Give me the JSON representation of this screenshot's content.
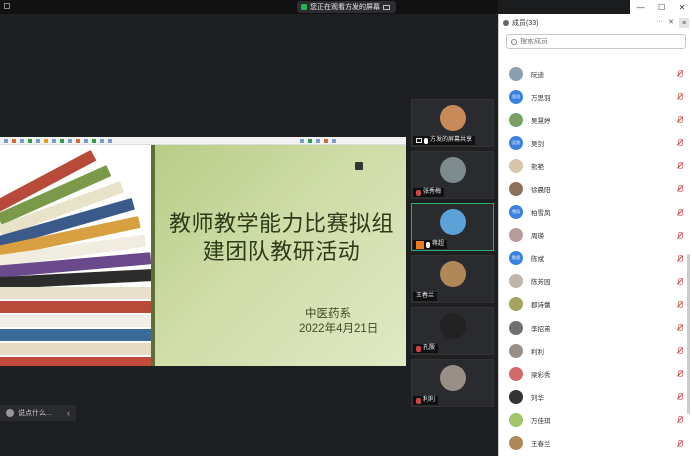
{
  "share_banner": "您正在观看方发的屏幕",
  "slide": {
    "title": "教师教学能力比赛拟组建团队教研活动",
    "department": "中医药系",
    "date": "2022年4月21日"
  },
  "chat_input_placeholder": "说点什么...",
  "thumbnails": [
    {
      "name": "方发的屏幕共享",
      "avatar_color": "#c88a58"
    },
    {
      "name": "张秀梅",
      "avatar_color": "#7d8a8e"
    },
    {
      "name": "蒋超",
      "avatar_color": "#5aa2d8"
    },
    {
      "name": "王春兰",
      "avatar_color": "#b08858"
    },
    {
      "name": "孔殷",
      "avatar_color": "#222222"
    },
    {
      "name": "利利",
      "avatar_color": "#9a8f86"
    }
  ],
  "panel": {
    "title": "成员(33)",
    "search_placeholder": "搜索成员"
  },
  "members": [
    {
      "name": "阮迪",
      "avatar_text": "",
      "color": "#8a9fb2"
    },
    {
      "name": "万思羽",
      "avatar_text": "思羽",
      "color": "#3b82e0"
    },
    {
      "name": "吴慧婷",
      "avatar_text": "",
      "color": "#7ba06a"
    },
    {
      "name": "吴剑",
      "avatar_text": "吴剑",
      "color": "#3b82e0"
    },
    {
      "name": "熊艳",
      "avatar_text": "",
      "color": "#d8c6a8"
    },
    {
      "name": "徐晨阳",
      "avatar_text": "",
      "color": "#8c7058"
    },
    {
      "name": "柏雪凤",
      "avatar_text": "雪凤",
      "color": "#3b82e0"
    },
    {
      "name": "周瑛",
      "avatar_text": "",
      "color": "#b89c9c"
    },
    {
      "name": "陈斌",
      "avatar_text": "陈斌",
      "color": "#3b82e0"
    },
    {
      "name": "陈芳园",
      "avatar_text": "",
      "color": "#c2b4a8"
    },
    {
      "name": "郡诗蕾",
      "avatar_text": "",
      "color": "#a8a25e"
    },
    {
      "name": "李招弟",
      "avatar_text": "",
      "color": "#707070"
    },
    {
      "name": "利利",
      "avatar_text": "",
      "color": "#9a8f86"
    },
    {
      "name": "梁彩秀",
      "avatar_text": "",
      "color": "#d26a6a"
    },
    {
      "name": "刘华",
      "avatar_text": "",
      "color": "#333333"
    },
    {
      "name": "万佳琪",
      "avatar_text": "",
      "color": "#a2c46a"
    },
    {
      "name": "王春兰",
      "avatar_text": "",
      "color": "#b08858"
    }
  ]
}
